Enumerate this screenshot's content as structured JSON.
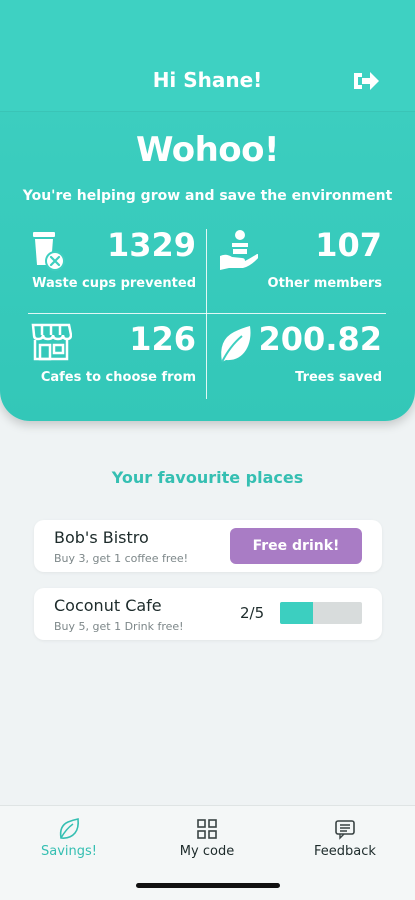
{
  "header": {
    "greeting": "Hi Shane!",
    "logout_icon": "logout-icon"
  },
  "hero": {
    "headline": "Wohoo!",
    "subline": "You're helping grow and save the environment",
    "stats": [
      {
        "value": "1329",
        "label": "Waste cups prevented",
        "icon": "cup-blocked-icon"
      },
      {
        "value": "107",
        "label": "Other members",
        "icon": "hand-person-icon"
      },
      {
        "value": "126",
        "label": "Cafes to choose from",
        "icon": "storefront-icon"
      },
      {
        "value": "200.82",
        "label": "Trees saved",
        "icon": "leaf-icon"
      }
    ]
  },
  "favourites": {
    "title": "Your favourite places",
    "places": [
      {
        "name": "Bob's Bistro",
        "offer": "Buy 3, get 1 coffee free!",
        "action_label": "Free drink!"
      },
      {
        "name": "Coconut Cafe",
        "offer": "Buy 5, get 1 Drink free!",
        "progress_label": "2/5",
        "progress": 0.4
      }
    ]
  },
  "tabs": [
    {
      "label": "Savings!",
      "icon": "leaf-icon",
      "active": true
    },
    {
      "label": "My code",
      "icon": "qr-code-icon",
      "active": false
    },
    {
      "label": "Feedback",
      "icon": "chat-bubble-icon",
      "active": false
    }
  ],
  "colors": {
    "accent": "#3ed1c2",
    "button_purple": "#a97cc5",
    "progress_track": "#d8dcdc"
  }
}
